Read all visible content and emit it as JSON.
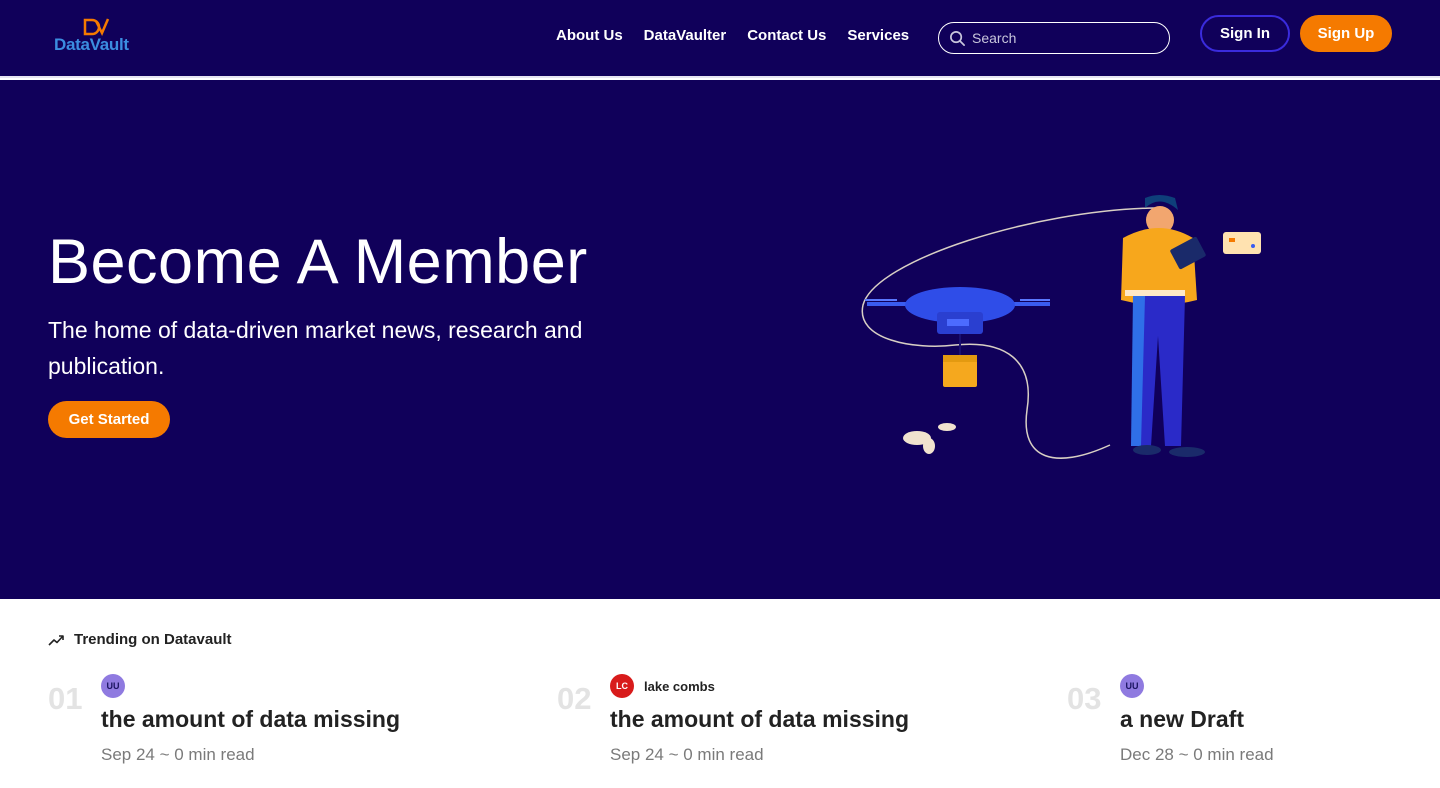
{
  "header": {
    "logo_text": "DataVault",
    "nav": [
      "About Us",
      "DataVaulter",
      "Contact Us",
      "Services"
    ],
    "search_placeholder": "Search",
    "signin_label": "Sign In",
    "signup_label": "Sign Up"
  },
  "hero": {
    "title": "Become A Member",
    "subtitle": "The home of data-driven market news, research and publication.",
    "cta_label": "Get Started"
  },
  "trending": {
    "title": "Trending on Datavault",
    "items": [
      {
        "number": "01",
        "avatar": "UU",
        "author": "",
        "title": "the amount of data missing",
        "meta": "Sep 24 ~ 0 min read"
      },
      {
        "number": "02",
        "avatar": "LC",
        "author": "lake combs",
        "title": "the amount of data missing",
        "meta": "Sep 24 ~ 0 min read"
      },
      {
        "number": "03",
        "avatar": "UU",
        "author": "",
        "title": "a new Draft",
        "meta": "Dec 28 ~ 0 min read"
      }
    ]
  },
  "colors": {
    "navy": "#10005a",
    "orange": "#f57a00",
    "signin_border": "#3a2bdc",
    "logo_blue": "#3b8de0"
  }
}
